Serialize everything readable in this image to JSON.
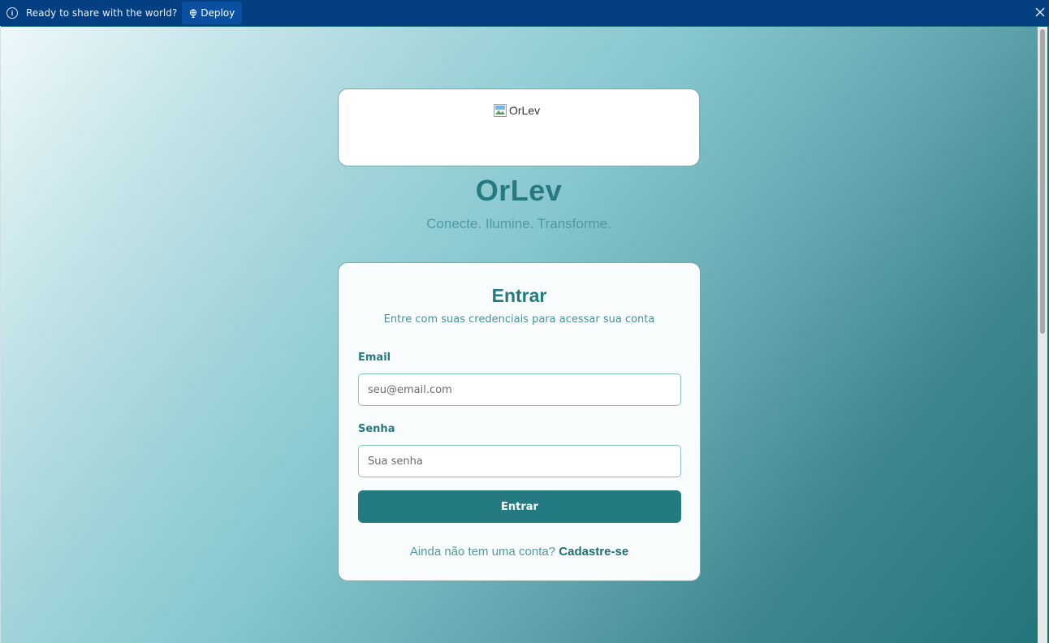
{
  "banner": {
    "message": "Ready to share with the world?",
    "deploy_label": "Deploy"
  },
  "logo": {
    "alt_text": "OrLev"
  },
  "brand": {
    "title": "OrLev",
    "tagline": "Conecte. Ilumine. Transforme."
  },
  "login": {
    "title": "Entrar",
    "subtitle": "Entre com suas credenciais para acessar sua conta",
    "email_label": "Email",
    "email_placeholder": "seu@email.com",
    "email_value": "",
    "password_label": "Senha",
    "password_placeholder": "Sua senha",
    "password_value": "",
    "submit_label": "Entrar",
    "signup_prompt": "Ainda não tem uma conta?",
    "signup_link": "Cadastre-se"
  },
  "colors": {
    "banner_bg": "#043f82",
    "primary": "#237a80",
    "tagline": "#4f9aa0"
  },
  "icons": {
    "banner_info": "info-icon",
    "deploy": "globe-icon",
    "close": "close-icon",
    "logo": "broken-image-icon"
  }
}
